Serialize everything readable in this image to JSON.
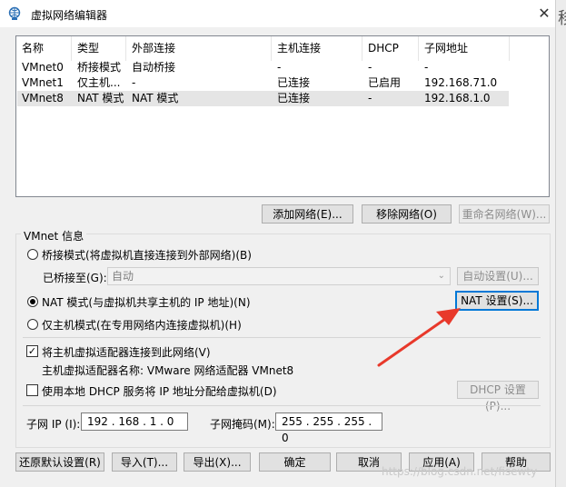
{
  "window": {
    "title": "虚拟网络编辑器",
    "close_glyph": "✕"
  },
  "side_glimpse": "移",
  "table": {
    "headers": [
      "名称",
      "类型",
      "外部连接",
      "主机连接",
      "DHCP",
      "子网地址"
    ],
    "rows": [
      [
        "VMnet0",
        "桥接模式",
        "自动桥接",
        "-",
        "-",
        "-"
      ],
      [
        "VMnet1",
        "仅主机...",
        "-",
        "已连接",
        "已启用",
        "192.168.71.0"
      ],
      [
        "VMnet8",
        "NAT 模式",
        "NAT 模式",
        "已连接",
        "-",
        "192.168.1.0"
      ]
    ]
  },
  "table_buttons": {
    "add": "添加网络(E)...",
    "remove": "移除网络(O)",
    "rename": "重命名网络(W)..."
  },
  "vmnet_info": {
    "title": "VMnet 信息",
    "bridged_label": "桥接模式(将虚拟机直接连接到外部网络)(B)",
    "bridged_to_label": "已桥接至(G):",
    "bridged_to_value": "自动",
    "auto_settings": "自动设置(U)...",
    "nat_label": "NAT 模式(与虚拟机共享主机的 IP 地址)(N)",
    "nat_settings": "NAT 设置(S)...",
    "host_only_label": "仅主机模式(在专用网络内连接虚拟机)(H)",
    "connect_adapter_label": "将主机虚拟适配器连接到此网络(V)",
    "adapter_name_label": "主机虚拟适配器名称: VMware 网络适配器 VMnet8",
    "dhcp_label": "使用本地 DHCP 服务将 IP 地址分配给虚拟机(D)",
    "dhcp_settings": "DHCP 设置(P)...",
    "subnet_ip_label": "子网 IP (I):",
    "subnet_ip_value": "192 . 168 . 1 . 0",
    "subnet_mask_label": "子网掩码(M):",
    "subnet_mask_value": "255 . 255 . 255 . 0",
    "selected_mode": "nat",
    "connect_adapter_checked": true,
    "dhcp_checked": false
  },
  "bottom_buttons": {
    "restore": "还原默认设置(R)",
    "import": "导入(T)...",
    "export": "导出(X)...",
    "ok": "确定",
    "cancel": "取消",
    "apply": "应用(A)",
    "help": "帮助"
  },
  "watermark": "https://blog.csdn.net/fisewty",
  "colors": {
    "annotation_arrow": "#e8392b",
    "focus_blue": "#0078d7"
  }
}
